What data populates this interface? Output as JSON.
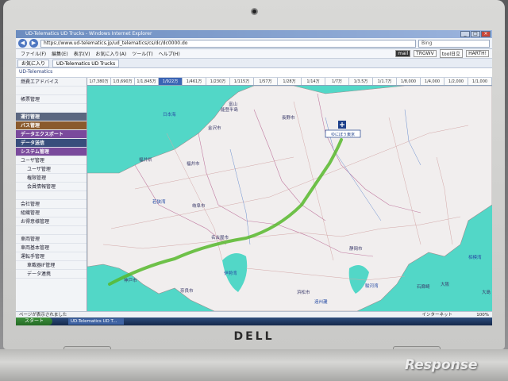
{
  "browser": {
    "title": "UD-Telematics UD Trucks - Windows Internet Explorer",
    "url": "https://www.ud-telematics.jp/ud_telematics/cs/dc/dc0000.do",
    "search_placeholder": "Bing",
    "menu": [
      "ファイル(F)",
      "編集(E)",
      "表示(V)",
      "お気に入り(A)",
      "ツール(T)",
      "ヘルプ(H)"
    ],
    "toolbar_chips": [
      "mail",
      "TRGWV",
      "tool日立",
      "HARTH!"
    ],
    "tabs": [
      "お気に入り",
      "UD-Telematics UD Trucks"
    ],
    "status_left": "ページが表示されました",
    "status_net": "インターネット",
    "status_zoom": "100%"
  },
  "app": {
    "header": "UD-Telematics"
  },
  "sidebar": {
    "items": [
      {
        "label": "燃費エアドバイス",
        "kind": "normal"
      },
      {
        "label": "",
        "kind": "normal"
      },
      {
        "label": "帳票管理",
        "kind": "normal"
      },
      {
        "label": "",
        "kind": "normal"
      },
      {
        "label": "運行管理",
        "kind": "section gray"
      },
      {
        "label": "バス管理",
        "kind": "section brown"
      },
      {
        "label": "データエクスポート",
        "kind": "section purple"
      },
      {
        "label": "データ送信",
        "kind": "section"
      },
      {
        "label": "システム管理",
        "kind": "section purple"
      },
      {
        "label": "ユーザ管理",
        "kind": "normal"
      },
      {
        "label": "ユーザ管理",
        "kind": "sub"
      },
      {
        "label": "権限管理",
        "kind": "sub"
      },
      {
        "label": "会員情報管理",
        "kind": "sub"
      },
      {
        "label": "",
        "kind": "normal"
      },
      {
        "label": "会社管理",
        "kind": "normal"
      },
      {
        "label": "組織管理",
        "kind": "normal"
      },
      {
        "label": "お得意様管理",
        "kind": "normal"
      },
      {
        "label": "",
        "kind": "normal"
      },
      {
        "label": "車両管理",
        "kind": "normal"
      },
      {
        "label": "車両基本管理",
        "kind": "normal"
      },
      {
        "label": "運転手管理",
        "kind": "normal"
      },
      {
        "label": "車載器IF管理",
        "kind": "sub"
      },
      {
        "label": "データ連携",
        "kind": "sub"
      }
    ]
  },
  "map": {
    "scales": [
      "1/7,380万",
      "1/3,690万",
      "1/1,845万",
      "1/922万",
      "1/461万",
      "1/230万",
      "1/115万",
      "1/57万",
      "1/28万",
      "1/14万",
      "1/7万",
      "1/3.5万",
      "1/1.7万",
      "1/8,000",
      "1/4,000",
      "1/2,000",
      "1/1,000"
    ],
    "active_scale_index": 3,
    "place_labels": [
      {
        "text": "日本海",
        "kind": "sea"
      },
      {
        "text": "能登半島",
        "kind": "city"
      },
      {
        "text": "長野市",
        "kind": "city"
      },
      {
        "text": "富山",
        "kind": "city"
      },
      {
        "text": "金沢市",
        "kind": "city"
      },
      {
        "text": "福井市",
        "kind": "city"
      },
      {
        "text": "若狭湾",
        "kind": "sea"
      },
      {
        "text": "岐阜市",
        "kind": "city"
      },
      {
        "text": "名古屋市",
        "kind": "city"
      },
      {
        "text": "伊勢湾",
        "kind": "sea"
      },
      {
        "text": "神戸市",
        "kind": "city"
      },
      {
        "text": "奈良市",
        "kind": "city"
      },
      {
        "text": "静岡市",
        "kind": "city"
      },
      {
        "text": "浜松市",
        "kind": "city"
      },
      {
        "text": "駿河湾",
        "kind": "sea"
      },
      {
        "text": "遠州灘",
        "kind": "sea"
      },
      {
        "text": "大阪",
        "kind": "city"
      },
      {
        "text": "石廊崎",
        "kind": "city"
      },
      {
        "text": "相模湾",
        "kind": "sea"
      },
      {
        "text": "大島",
        "kind": "city"
      },
      {
        "text": "福井県",
        "kind": "city"
      }
    ],
    "marker_label": "ゆにぼう東京"
  },
  "taskbar": {
    "start": "スタート",
    "item": "UD-Telematics UD T..."
  },
  "brand": "DELL",
  "watermark": "Response"
}
